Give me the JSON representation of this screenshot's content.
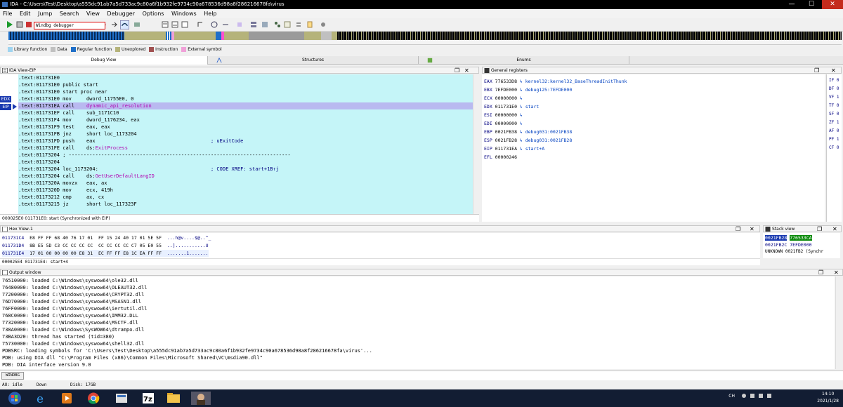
{
  "window": {
    "title": "IDA - C:\\Users\\Test\\Desktop\\a555dc91ab7a5d733ac9c80a6f1b932fe9734c90a678536d98a8f286216678fa\\virus",
    "minimize": "—",
    "maximize": "☐",
    "close": "✕"
  },
  "menu": [
    "File",
    "Edit",
    "Jump",
    "Search",
    "View",
    "Debugger",
    "Options",
    "Windows",
    "Help"
  ],
  "toolbar": {
    "debugger_select": "Windbg debugger"
  },
  "legend": [
    {
      "label": "Library function",
      "color": "#9fd4f0"
    },
    {
      "label": "Data",
      "color": "#c0c0c0"
    },
    {
      "label": "Regular function",
      "color": "#1f6fc8"
    },
    {
      "label": "Unexplored",
      "color": "#b5b37a"
    },
    {
      "label": "Instruction",
      "color": "#a05050"
    },
    {
      "label": "External symbol",
      "color": "#f0a0d8"
    }
  ],
  "tabs": [
    "Debug View",
    "Structures",
    "Enums"
  ],
  "ida_view": {
    "title": "IDA View-EIP",
    "gutter": [
      "EDX",
      "EIP"
    ],
    "lines": [
      {
        "addr": ".text:011731E0",
        "text": ""
      },
      {
        "addr": ".text:011731E0",
        "text": "public start"
      },
      {
        "addr": ".text:011731E0",
        "text": "start proc near"
      },
      {
        "addr": ".text:011731E0",
        "text": "mov     dword_11755E0, 0"
      },
      {
        "addr": ".text:011731EA",
        "text": "call    ",
        "fn": "dynamic_api_resolution"
      },
      {
        "addr": ".text:011731EF",
        "text": "call    sub_1171C10"
      },
      {
        "addr": ".text:011731F4",
        "text": "mov     dword_1176234, eax"
      },
      {
        "addr": ".text:011731F9",
        "text": "test    eax, eax"
      },
      {
        "addr": ".text:011731FB",
        "text": "jnz     short loc_1173204"
      },
      {
        "addr": ".text:011731FD",
        "text": "push    eax",
        "comment": "; uExitCode"
      },
      {
        "addr": ".text:011731FE",
        "text": "call    ds:",
        "fn": "ExitProcess"
      },
      {
        "addr": ".text:01173204",
        "text": "; ---------------------------------------------------------------------------"
      },
      {
        "addr": ".text:01173204",
        "text": ""
      },
      {
        "addr": ".text:01173204",
        "text": "loc_1173204:",
        "comment": "; CODE XREF: start+1B↑j"
      },
      {
        "addr": ".text:01173204",
        "text": "call    ds:",
        "fn": "GetUserDefaultLangID"
      },
      {
        "addr": ".text:0117320A",
        "text": "movzx   eax, ax"
      },
      {
        "addr": ".text:0117320D",
        "text": "mov     ecx, 419h"
      },
      {
        "addr": ".text:01173212",
        "text": "cmp     ax, cx"
      },
      {
        "addr": ".text:01173215",
        "text": "jz      short loc_117323F"
      }
    ],
    "status": "000025E0 011731E0: start (Synchronized with EIP)"
  },
  "registers": {
    "title": "General registers",
    "rows": [
      {
        "name": "EAX",
        "value": "776533D8",
        "ref": "kernel32:kernel32_BaseThreadInitThunk"
      },
      {
        "name": "EBX",
        "value": "7EFDE000",
        "ref": "debug125:7EFDE000"
      },
      {
        "name": "ECX",
        "value": "00000000",
        "ref": ""
      },
      {
        "name": "EDX",
        "value": "011731E0",
        "ref": "start"
      },
      {
        "name": "ESI",
        "value": "00000000",
        "ref": ""
      },
      {
        "name": "EDI",
        "value": "00000000",
        "ref": ""
      },
      {
        "name": "EBP",
        "value": "0021FB38",
        "ref": "debug031:0021FB38"
      },
      {
        "name": "ESP",
        "value": "0021FB28",
        "ref": "debug031:0021FB28"
      },
      {
        "name": "EIP",
        "value": "011731EA",
        "ref": "start+A"
      },
      {
        "name": "EFL",
        "value": "00000246",
        "ref": ""
      }
    ],
    "flags": [
      "IF 0",
      "DF 0",
      "VF 1",
      "TF 0",
      "SF 0",
      "ZF 1",
      "AF 0",
      "PF 1",
      "CF 0"
    ]
  },
  "hex_view": {
    "title": "Hex View-1",
    "rows": [
      {
        "addr": "011731C4",
        "bytes": "E8 FF FF 68 40 76 17 01  FF 15 24 40 17 01 5E 5F",
        "ascii": "...h@v....$@..^_"
      },
      {
        "addr": "011731D4",
        "bytes": "8B E5 5D C3 CC CC CC CC  CC CC CC CC C7 05 E0 55",
        "ascii": "..]...........U"
      },
      {
        "addr": "011731E4",
        "bytes": "17 01 00 00 00 00 E8 31  EC FF FF E8 1C EA FF FF",
        "ascii": ".......1......."
      }
    ],
    "status": "000025E4 011731E4: start+4"
  },
  "stack_view": {
    "title": "Stack view",
    "rows": [
      {
        "addr": "0021FB28",
        "value": "776533CA"
      },
      {
        "addr": "0021FB2C",
        "value": "7EFDE000"
      }
    ],
    "footer": "UNKNOWN 0021FB2 (Synchr"
  },
  "output": {
    "title": "Output window",
    "lines": [
      "76510000: loaded C:\\Windows\\syswow64\\ole32.dll",
      "76480000: loaded C:\\Windows\\syswow64\\OLEAUT32.dll",
      "77200000: loaded C:\\Windows\\syswow64\\CRYPT32.dll",
      "76D70000: loaded C:\\Windows\\syswow64\\MSASN1.dll",
      "76FF0000: loaded C:\\Windows\\syswow64\\iertutil.dll",
      "768C0000: loaded C:\\Windows\\syswow64\\IMM32.DLL",
      "77320000: loaded C:\\Windows\\syswow64\\MSCTF.dll",
      "738A0000: loaded C:\\Windows\\SysWOW64\\dtrampo.dll",
      "73BA3D20: thread has started (tid=380)",
      "75730000: loaded C:\\Windows\\syswow64\\shell32.dll",
      "PDBSRC: loading symbols for 'C:\\Users\\Test\\Desktop\\a555dc91ab7a5d733ac9c80a6f1b932fe9734c90a678536d98a8f286216678fa\\virus'...",
      "PDB: using DIA dll \"C:\\Program Files (x86)\\Common Files\\Microsoft Shared\\VC\\msdia90.dll\"",
      "PDB: DIA interface version 9.0"
    ]
  },
  "command": {
    "button": "WINDBG"
  },
  "status": {
    "au": "AU:  idle",
    "dir": "Down",
    "disk": "Disk: 17GB"
  },
  "tray": {
    "ime": "CH",
    "time": "14:10",
    "date": "2021/1/28"
  }
}
